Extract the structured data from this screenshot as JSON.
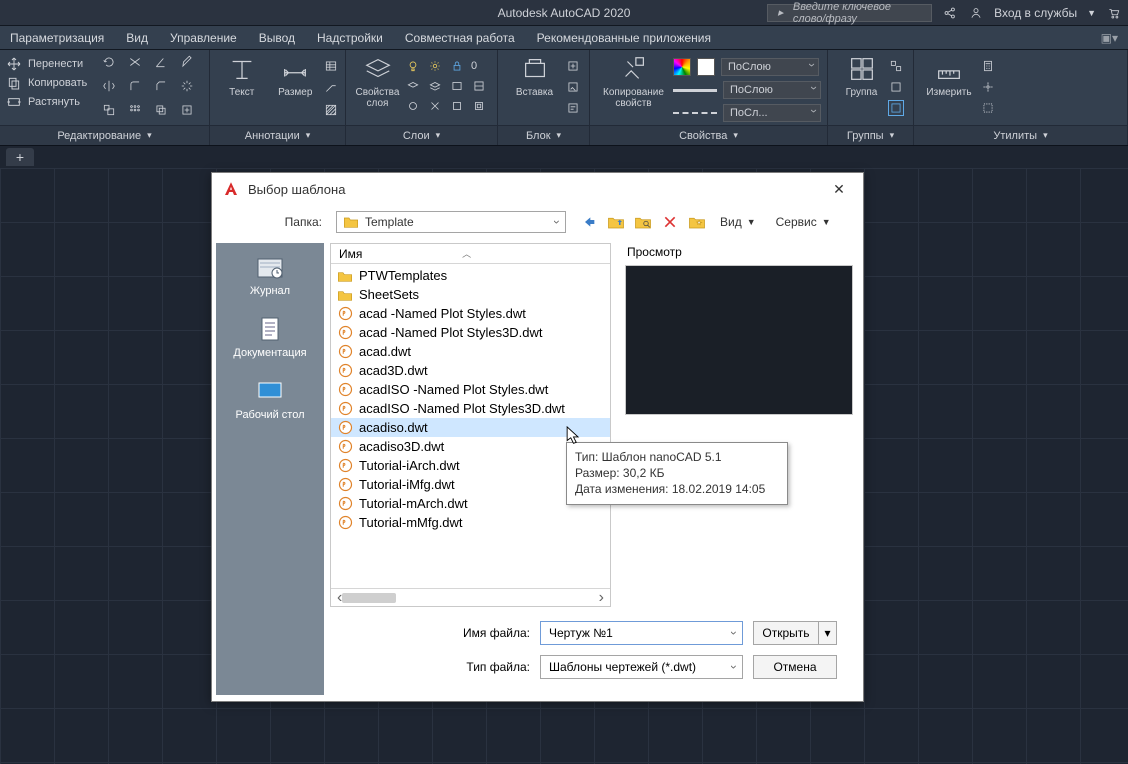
{
  "app": {
    "title": "Autodesk AutoCAD 2020"
  },
  "topbar": {
    "search_placeholder": "Введите ключевое слово/фразу",
    "login": "Вход в службы"
  },
  "menus": [
    "Параметризация",
    "Вид",
    "Управление",
    "Вывод",
    "Надстройки",
    "Совместная работа",
    "Рекомендованные приложения"
  ],
  "ribbon": {
    "edit": {
      "items": [
        "Перенести",
        "Копировать",
        "Растянуть"
      ],
      "caption": "Редактирование"
    },
    "annot": {
      "text": "Текст",
      "dim": "Размер",
      "caption": "Аннотации"
    },
    "layers": {
      "props": "Свойства слоя",
      "caption": "Слои"
    },
    "block": {
      "insert": "Вставка",
      "caption": "Блок"
    },
    "props": {
      "copy": "Копирование свойств",
      "caption": "Свойства",
      "byLayer1": "ПоСлою",
      "byLayer2": "ПоСлою",
      "byLayer3": "ПоСл..."
    },
    "groups": {
      "group": "Группа",
      "caption": "Группы"
    },
    "utils": {
      "measure": "Измерить",
      "caption": "Утилиты"
    }
  },
  "dialog": {
    "title": "Выбор шаблона",
    "folder_label": "Папка:",
    "folder_value": "Template",
    "view": "Вид",
    "service": "Сервис",
    "places": {
      "history": "Журнал",
      "docs": "Документация",
      "desktop": "Рабочий стол"
    },
    "list_header": "Имя",
    "preview_label": "Просмотр",
    "files": [
      {
        "kind": "folder",
        "name": "PTWTemplates"
      },
      {
        "kind": "folder",
        "name": "SheetSets"
      },
      {
        "kind": "dwt",
        "name": "acad -Named Plot Styles.dwt"
      },
      {
        "kind": "dwt",
        "name": "acad -Named Plot Styles3D.dwt"
      },
      {
        "kind": "dwt",
        "name": "acad.dwt"
      },
      {
        "kind": "dwt",
        "name": "acad3D.dwt"
      },
      {
        "kind": "dwt",
        "name": "acadISO -Named Plot Styles.dwt"
      },
      {
        "kind": "dwt",
        "name": "acadISO -Named Plot Styles3D.dwt"
      },
      {
        "kind": "dwt",
        "name": "acadiso.dwt",
        "selected": true
      },
      {
        "kind": "dwt",
        "name": "acadiso3D.dwt"
      },
      {
        "kind": "dwt",
        "name": "Tutorial-iArch.dwt"
      },
      {
        "kind": "dwt",
        "name": "Tutorial-iMfg.dwt"
      },
      {
        "kind": "dwt",
        "name": "Tutorial-mArch.dwt"
      },
      {
        "kind": "dwt",
        "name": "Tutorial-mMfg.dwt"
      }
    ],
    "tooltip": {
      "l1": "Тип: Шаблон nanoCAD 5.1",
      "l2": "Размер: 30,2 КБ",
      "l3": "Дата изменения: 18.02.2019 14:05"
    },
    "filename_label": "Имя файла:",
    "filename_value": "Чертуж №1",
    "filetype_label": "Тип файла:",
    "filetype_value": "Шаблоны чертежей (*.dwt)",
    "open": "Открыть",
    "cancel": "Отмена"
  }
}
